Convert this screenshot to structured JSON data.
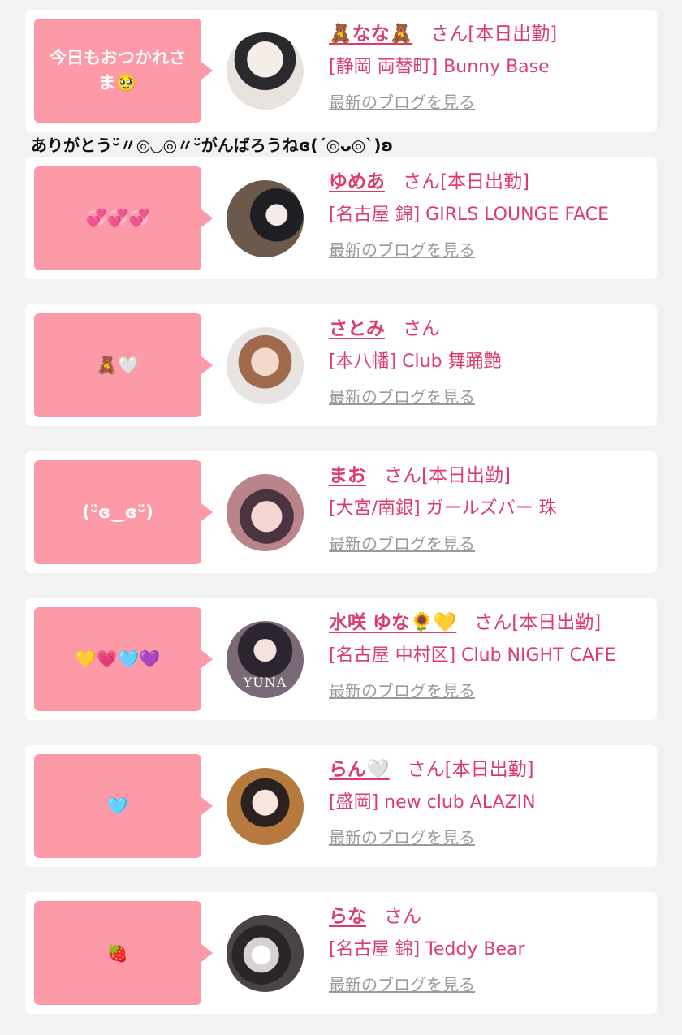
{
  "overflow_text": "ありがとうᵕ̈〃◎◡◎〃ᵕ̈がんばろうねɞ(ˊ◎ᴗ◎ˋ)ʚ",
  "blog_link_label": "最新のブログを見る",
  "san_suffix": "さん",
  "cards": [
    {
      "message": "今日もおつかれさ\nま🥹",
      "name": "🧸なな🧸",
      "status": "[本日出勤]",
      "shop": "[静岡 両替町] Bunny Base",
      "avatar_caption": ""
    },
    {
      "message": "💞💞💞",
      "name": "ゆめあ",
      "status": "[本日出勤]",
      "shop": "[名古屋 錦] GIRLS LOUNGE FACE",
      "avatar_caption": ""
    },
    {
      "message": "🧸🤍",
      "name": "さとみ",
      "status": "",
      "shop": "[本八幡] Club 舞踊艶",
      "avatar_caption": ""
    },
    {
      "message": "(ᵕ̈ɞ‿ɞᵕ̈)",
      "name": "まお",
      "status": "[本日出勤]",
      "shop": "[大宮/南銀] ガールズバー 珠",
      "avatar_caption": ""
    },
    {
      "message": "💛💗🩵💜",
      "name": "水咲 ゆな🌻💛",
      "status": "[本日出勤]",
      "shop": "[名古屋 中村区] Club NIGHT CAFE",
      "avatar_caption": "YUNA"
    },
    {
      "message": "🩵",
      "name": "らん🤍",
      "status": "[本日出勤]",
      "shop": "[盛岡] new club ALAZIN",
      "avatar_caption": ""
    },
    {
      "message": "🍓",
      "name": "らな",
      "status": "",
      "shop": "[名古屋 錦] Teddy Bear",
      "avatar_caption": ""
    }
  ]
}
